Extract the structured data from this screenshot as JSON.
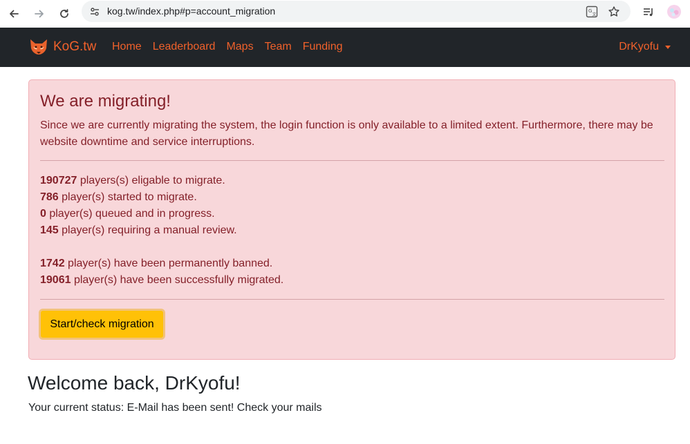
{
  "browser": {
    "url": "kog.tw/index.php#p=account_migration"
  },
  "navbar": {
    "brand": "KoG.tw",
    "links": [
      "Home",
      "Leaderboard",
      "Maps",
      "Team",
      "Funding"
    ],
    "user": "DrKyofu"
  },
  "alert": {
    "heading": "We are migrating!",
    "text": "Since we are currently migrating the system, the login function is only available to a limited extent. Furthermore, there may be website downtime and service interruptions.",
    "stats": [
      {
        "value": "190727",
        "label": " players(s) eligable to migrate."
      },
      {
        "value": "786",
        "label": " player(s) started to migrate."
      },
      {
        "value": "0",
        "label": " player(s) queued and in progress."
      },
      {
        "value": "145",
        "label": " player(s) requiring a manual review."
      }
    ],
    "stats2": [
      {
        "value": "1742",
        "label": " player(s) have been permanently banned."
      },
      {
        "value": "19061",
        "label": " player(s) have been successfully migrated."
      }
    ],
    "button": "Start/check migration"
  },
  "welcome": {
    "title": "Welcome back, DrKyofu!",
    "status": "Your current status: E-Mail has been sent! Check your mails"
  },
  "colors": {
    "accent": "#f0612b",
    "navbar_bg": "#212529",
    "alert_bg": "#f8d7da",
    "alert_text": "#842029",
    "button_bg": "#ffc107"
  }
}
